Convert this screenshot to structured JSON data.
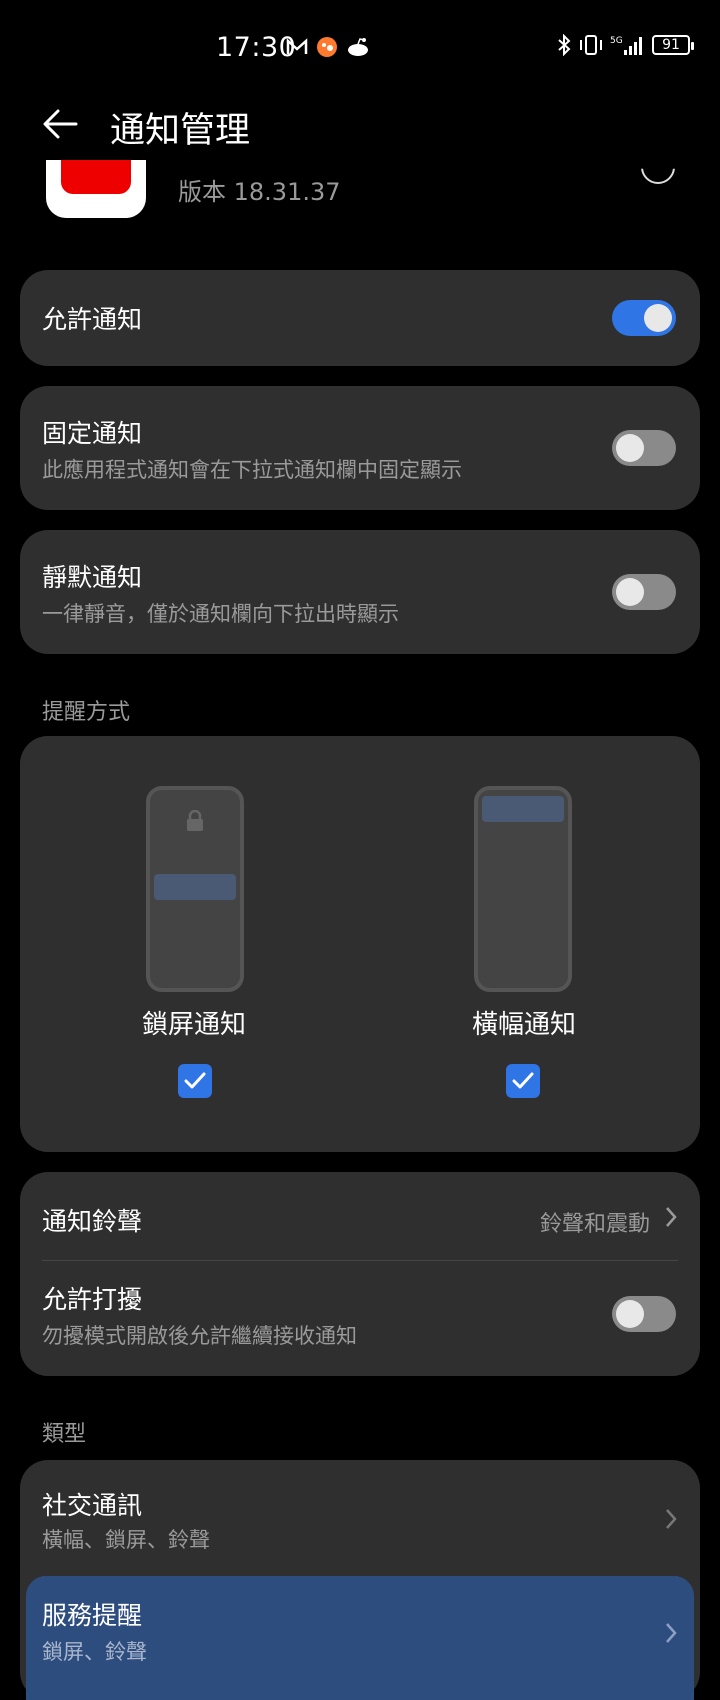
{
  "status": {
    "time": "17:30",
    "battery": "91",
    "network": "5G"
  },
  "header": {
    "title": "通知管理"
  },
  "app": {
    "version": "版本 18.31.37"
  },
  "allow_notifications": {
    "title": "允許通知",
    "enabled": true
  },
  "pinned": {
    "title": "固定通知",
    "subtitle": "此應用程式通知會在下拉式通知欄中固定顯示",
    "enabled": false
  },
  "silent": {
    "title": "靜默通知",
    "subtitle": "一律靜音，僅於通知欄向下拉出時顯示",
    "enabled": false
  },
  "alert_section": {
    "label": "提醒方式",
    "lockscreen": {
      "label": "鎖屏通知",
      "checked": true
    },
    "banner": {
      "label": "橫幅通知",
      "checked": true
    }
  },
  "sound": {
    "title": "通知鈴聲",
    "value": "鈴聲和震動"
  },
  "dnd": {
    "title": "允許打擾",
    "subtitle": "勿擾模式開啟後允許繼續接收通知",
    "enabled": false
  },
  "types_section": {
    "label": "類型",
    "items": [
      {
        "title": "社交通訊",
        "subtitle": "橫幅、鎖屏、鈴聲"
      },
      {
        "title": "服務提醒",
        "subtitle": "鎖屏、鈴聲"
      }
    ]
  },
  "colors": {
    "accent": "#2f75e6",
    "card": "#2f2f2f",
    "highlight": "#2e4d7f"
  }
}
